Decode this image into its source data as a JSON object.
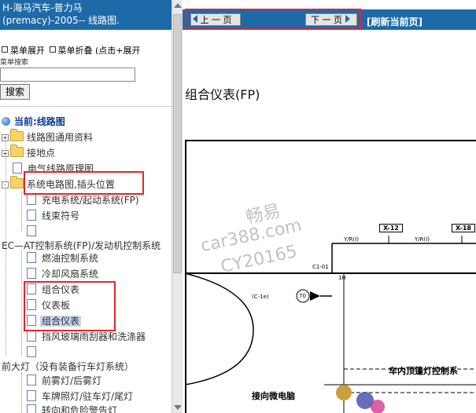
{
  "left_panel": {
    "header_line1": "H-海马汽车-普力马",
    "header_line2": "(premacy)-2005-- 线路图.",
    "menu_expand": "菜单展开",
    "menu_collapse": "菜单折叠 (点击+展开",
    "search_label": "菜单搜索",
    "search_value": "",
    "search_button": "搜索",
    "current_label": "当前:线路图",
    "tree": [
      {
        "label": "线路图通用资料"
      },
      {
        "label": "接地点"
      },
      {
        "label": "电气线路原理图"
      },
      {
        "label": "系统电路图,插头位置"
      },
      {
        "label": "充电系统/起动系统(FP)"
      },
      {
        "label": "线束符号"
      },
      {
        "label": ""
      },
      {
        "label": "EC—AT控制系统(FP)/发动机控制系统"
      },
      {
        "label": "燃油控制系统"
      },
      {
        "label": "冷却风扇系统"
      },
      {
        "label": "组合仪表"
      },
      {
        "label": "仪表板"
      },
      {
        "label": "组合仪表"
      },
      {
        "label": "挡风玻璃雨刮器和洗涤器"
      },
      {
        "label": ""
      },
      {
        "label": "前大灯（没有装备行车灯系统）"
      },
      {
        "label": "前雾灯/后雾灯"
      },
      {
        "label": "车牌照灯/驻车灯/尾灯"
      },
      {
        "label": "转向和危险警告灯"
      }
    ]
  },
  "right_panel": {
    "prev_button": "上 一 页",
    "next_button": "下 一 页",
    "refresh_link": "[刷新当前页]",
    "doc_title": "组合仪表(FP)",
    "watermark": [
      "畅易",
      "car388.com",
      "CY20165"
    ],
    "tags": [
      "X-12",
      "X-18"
    ],
    "wire_labels": [
      "Y/R(I)",
      "Y/R(I)",
      "C1-01",
      "1H",
      "(C-1e)",
      "70"
    ],
    "section_label_1": "车内顶篷灯控制系",
    "section_label_2": "接向微电脑"
  },
  "colors": {
    "header_blue": "#1e6aa8",
    "highlight_red": "#e0262e",
    "selected_bg": "#c6d6ec"
  }
}
